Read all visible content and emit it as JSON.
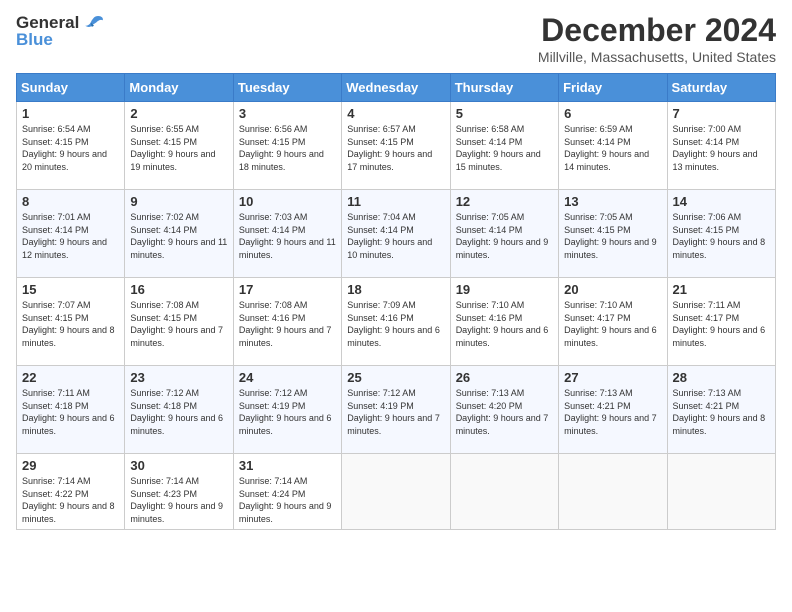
{
  "header": {
    "logo_general": "General",
    "logo_blue": "Blue",
    "month_title": "December 2024",
    "location": "Millville, Massachusetts, United States"
  },
  "days_of_week": [
    "Sunday",
    "Monday",
    "Tuesday",
    "Wednesday",
    "Thursday",
    "Friday",
    "Saturday"
  ],
  "weeks": [
    [
      {
        "day": "1",
        "sunrise": "Sunrise: 6:54 AM",
        "sunset": "Sunset: 4:15 PM",
        "daylight": "Daylight: 9 hours and 20 minutes."
      },
      {
        "day": "2",
        "sunrise": "Sunrise: 6:55 AM",
        "sunset": "Sunset: 4:15 PM",
        "daylight": "Daylight: 9 hours and 19 minutes."
      },
      {
        "day": "3",
        "sunrise": "Sunrise: 6:56 AM",
        "sunset": "Sunset: 4:15 PM",
        "daylight": "Daylight: 9 hours and 18 minutes."
      },
      {
        "day": "4",
        "sunrise": "Sunrise: 6:57 AM",
        "sunset": "Sunset: 4:15 PM",
        "daylight": "Daylight: 9 hours and 17 minutes."
      },
      {
        "day": "5",
        "sunrise": "Sunrise: 6:58 AM",
        "sunset": "Sunset: 4:14 PM",
        "daylight": "Daylight: 9 hours and 15 minutes."
      },
      {
        "day": "6",
        "sunrise": "Sunrise: 6:59 AM",
        "sunset": "Sunset: 4:14 PM",
        "daylight": "Daylight: 9 hours and 14 minutes."
      },
      {
        "day": "7",
        "sunrise": "Sunrise: 7:00 AM",
        "sunset": "Sunset: 4:14 PM",
        "daylight": "Daylight: 9 hours and 13 minutes."
      }
    ],
    [
      {
        "day": "8",
        "sunrise": "Sunrise: 7:01 AM",
        "sunset": "Sunset: 4:14 PM",
        "daylight": "Daylight: 9 hours and 12 minutes."
      },
      {
        "day": "9",
        "sunrise": "Sunrise: 7:02 AM",
        "sunset": "Sunset: 4:14 PM",
        "daylight": "Daylight: 9 hours and 11 minutes."
      },
      {
        "day": "10",
        "sunrise": "Sunrise: 7:03 AM",
        "sunset": "Sunset: 4:14 PM",
        "daylight": "Daylight: 9 hours and 11 minutes."
      },
      {
        "day": "11",
        "sunrise": "Sunrise: 7:04 AM",
        "sunset": "Sunset: 4:14 PM",
        "daylight": "Daylight: 9 hours and 10 minutes."
      },
      {
        "day": "12",
        "sunrise": "Sunrise: 7:05 AM",
        "sunset": "Sunset: 4:14 PM",
        "daylight": "Daylight: 9 hours and 9 minutes."
      },
      {
        "day": "13",
        "sunrise": "Sunrise: 7:05 AM",
        "sunset": "Sunset: 4:15 PM",
        "daylight": "Daylight: 9 hours and 9 minutes."
      },
      {
        "day": "14",
        "sunrise": "Sunrise: 7:06 AM",
        "sunset": "Sunset: 4:15 PM",
        "daylight": "Daylight: 9 hours and 8 minutes."
      }
    ],
    [
      {
        "day": "15",
        "sunrise": "Sunrise: 7:07 AM",
        "sunset": "Sunset: 4:15 PM",
        "daylight": "Daylight: 9 hours and 8 minutes."
      },
      {
        "day": "16",
        "sunrise": "Sunrise: 7:08 AM",
        "sunset": "Sunset: 4:15 PM",
        "daylight": "Daylight: 9 hours and 7 minutes."
      },
      {
        "day": "17",
        "sunrise": "Sunrise: 7:08 AM",
        "sunset": "Sunset: 4:16 PM",
        "daylight": "Daylight: 9 hours and 7 minutes."
      },
      {
        "day": "18",
        "sunrise": "Sunrise: 7:09 AM",
        "sunset": "Sunset: 4:16 PM",
        "daylight": "Daylight: 9 hours and 6 minutes."
      },
      {
        "day": "19",
        "sunrise": "Sunrise: 7:10 AM",
        "sunset": "Sunset: 4:16 PM",
        "daylight": "Daylight: 9 hours and 6 minutes."
      },
      {
        "day": "20",
        "sunrise": "Sunrise: 7:10 AM",
        "sunset": "Sunset: 4:17 PM",
        "daylight": "Daylight: 9 hours and 6 minutes."
      },
      {
        "day": "21",
        "sunrise": "Sunrise: 7:11 AM",
        "sunset": "Sunset: 4:17 PM",
        "daylight": "Daylight: 9 hours and 6 minutes."
      }
    ],
    [
      {
        "day": "22",
        "sunrise": "Sunrise: 7:11 AM",
        "sunset": "Sunset: 4:18 PM",
        "daylight": "Daylight: 9 hours and 6 minutes."
      },
      {
        "day": "23",
        "sunrise": "Sunrise: 7:12 AM",
        "sunset": "Sunset: 4:18 PM",
        "daylight": "Daylight: 9 hours and 6 minutes."
      },
      {
        "day": "24",
        "sunrise": "Sunrise: 7:12 AM",
        "sunset": "Sunset: 4:19 PM",
        "daylight": "Daylight: 9 hours and 6 minutes."
      },
      {
        "day": "25",
        "sunrise": "Sunrise: 7:12 AM",
        "sunset": "Sunset: 4:19 PM",
        "daylight": "Daylight: 9 hours and 7 minutes."
      },
      {
        "day": "26",
        "sunrise": "Sunrise: 7:13 AM",
        "sunset": "Sunset: 4:20 PM",
        "daylight": "Daylight: 9 hours and 7 minutes."
      },
      {
        "day": "27",
        "sunrise": "Sunrise: 7:13 AM",
        "sunset": "Sunset: 4:21 PM",
        "daylight": "Daylight: 9 hours and 7 minutes."
      },
      {
        "day": "28",
        "sunrise": "Sunrise: 7:13 AM",
        "sunset": "Sunset: 4:21 PM",
        "daylight": "Daylight: 9 hours and 8 minutes."
      }
    ],
    [
      {
        "day": "29",
        "sunrise": "Sunrise: 7:14 AM",
        "sunset": "Sunset: 4:22 PM",
        "daylight": "Daylight: 9 hours and 8 minutes."
      },
      {
        "day": "30",
        "sunrise": "Sunrise: 7:14 AM",
        "sunset": "Sunset: 4:23 PM",
        "daylight": "Daylight: 9 hours and 9 minutes."
      },
      {
        "day": "31",
        "sunrise": "Sunrise: 7:14 AM",
        "sunset": "Sunset: 4:24 PM",
        "daylight": "Daylight: 9 hours and 9 minutes."
      },
      null,
      null,
      null,
      null
    ]
  ]
}
